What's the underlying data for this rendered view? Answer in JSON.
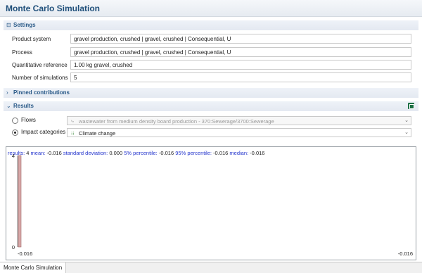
{
  "header": {
    "title": "Monte Carlo Simulation"
  },
  "settings": {
    "header_label": "Settings",
    "fields": [
      {
        "label": "Product system",
        "value": "gravel production, crushed | gravel, crushed | Consequential, U"
      },
      {
        "label": "Process",
        "value": "gravel production, crushed | gravel, crushed | Consequential, U"
      },
      {
        "label": "Quantitative reference",
        "value": "1.00 kg gravel, crushed"
      },
      {
        "label": "Number of simulations",
        "value": "5"
      }
    ]
  },
  "pinned": {
    "header_label": "Pinned contributions"
  },
  "results": {
    "header_label": "Results",
    "flows_label": "Flows",
    "flows_value": "wastewater from medium density board production - 370:Sewerage/3700:Sewerage",
    "impact_label": "Impact categories",
    "impact_value": "Climate change",
    "selected_option": "Impact categories"
  },
  "stats": {
    "results_key": "results:",
    "results_val": "4",
    "mean_key": "mean:",
    "mean_val": "-0.016",
    "std_key": "standard deviation:",
    "std_val": "0.000",
    "p5_key": "5% percentile:",
    "p5_val": "-0.016",
    "p95_key": "95% percentile:",
    "p95_val": "-0.016",
    "median_key": "median:",
    "median_val": "-0.016"
  },
  "chart_data": {
    "type": "bar",
    "title": "",
    "xlabel": "",
    "ylabel": "",
    "x_ticks": [
      "-0.016",
      "-0.016"
    ],
    "y_ticks": [
      "0",
      "4"
    ],
    "ylim": [
      0,
      4
    ],
    "bars": [
      {
        "x": -0.016,
        "count": 4
      }
    ],
    "bar_color": "#d8a8a8"
  },
  "footer": {
    "tab_label": "Monte Carlo Simulation"
  }
}
